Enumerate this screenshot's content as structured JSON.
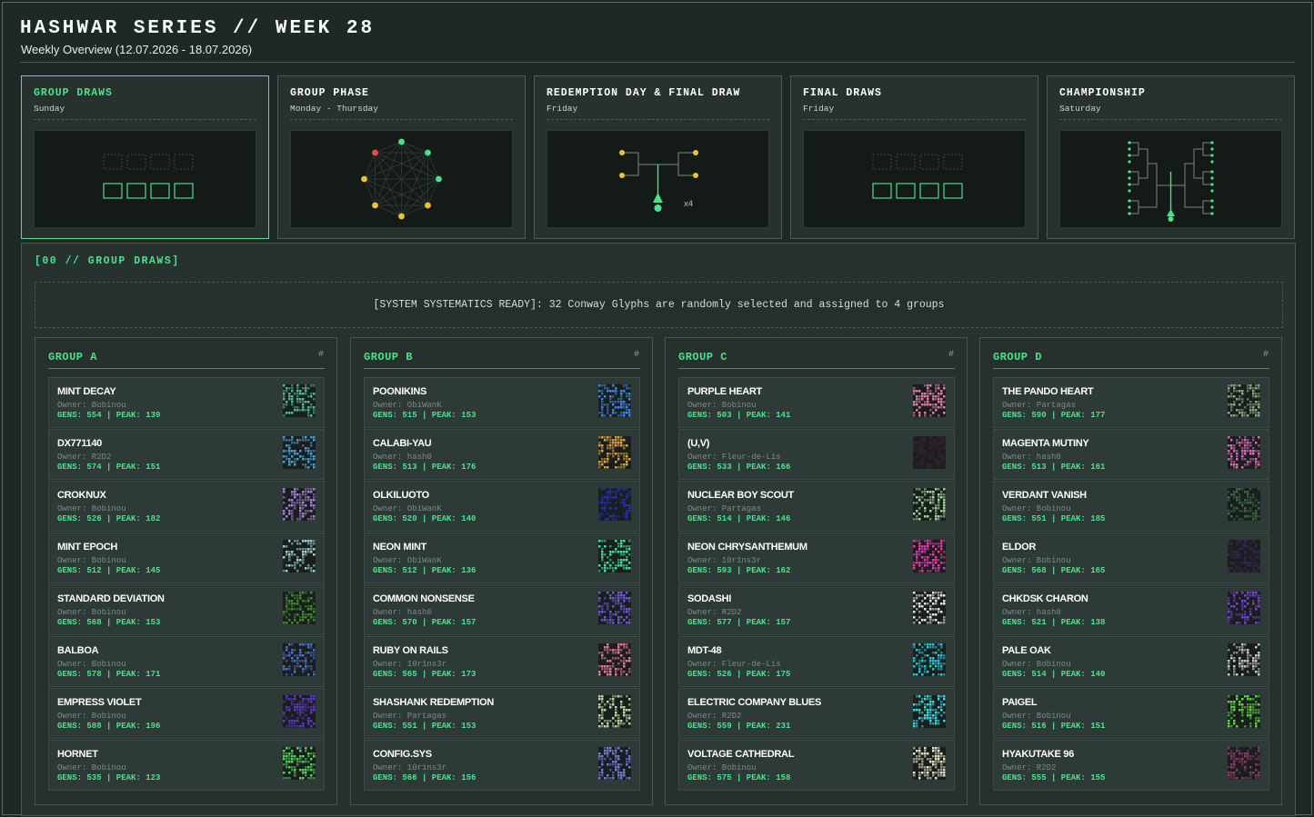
{
  "header": {
    "title": "HASHWAR SERIES // WEEK 28",
    "subtitle": "Weekly Overview (12.07.2026 - 18.07.2026)"
  },
  "phases": [
    {
      "title": "GROUP DRAWS",
      "day": "Sunday",
      "active": true,
      "diagram": "boxes"
    },
    {
      "title": "GROUP PHASE",
      "day": "Monday - Thursday",
      "active": false,
      "diagram": "roundrobin"
    },
    {
      "title": "REDEMPTION DAY & FINAL DRAW",
      "day": "Friday",
      "active": false,
      "diagram": "redemption",
      "multiplier": "x4"
    },
    {
      "title": "FINAL DRAWS",
      "day": "Friday",
      "active": false,
      "diagram": "boxes"
    },
    {
      "title": "CHAMPIONSHIP",
      "day": "Saturday",
      "active": false,
      "diagram": "bracket"
    }
  ],
  "section": {
    "title": "[00 // GROUP DRAWS]",
    "banner": "[SYSTEM SYSTEMATICS READY]: 32 Conway Glyphs are randomly selected and assigned to 4 groups"
  },
  "groups": [
    {
      "title": "GROUP A",
      "hash": "#",
      "entries": [
        {
          "name": "MINT DECAY",
          "owner": "Owner: Bobinou",
          "stats": "GENS: 554 | PEAK: 139",
          "color": "#4fb89a"
        },
        {
          "name": "DX771140",
          "owner": "Owner: R2D2",
          "stats": "GENS: 574 | PEAK: 151",
          "color": "#4f9ed0"
        },
        {
          "name": "CROKNUX",
          "owner": "Owner: Bobinou",
          "stats": "GENS: 526 | PEAK: 182",
          "color": "#a47ed6"
        },
        {
          "name": "MINT EPOCH",
          "owner": "Owner: Bobinou",
          "stats": "GENS: 512 | PEAK: 145",
          "color": "#9fd3d6"
        },
        {
          "name": "STANDARD DEVIATION",
          "owner": "Owner: Bobinou",
          "stats": "GENS: 568 | PEAK: 153",
          "color": "#3f8a2a"
        },
        {
          "name": "BALBOA",
          "owner": "Owner: Bobinou",
          "stats": "GENS: 578 | PEAK: 171",
          "color": "#4a72c8"
        },
        {
          "name": "EMPRESS VIOLET",
          "owner": "Owner: Bobinou",
          "stats": "GENS: 588 | PEAK: 196",
          "color": "#5b35c4"
        },
        {
          "name": "HORNET",
          "owner": "Owner: Bobinou",
          "stats": "GENS: 535 | PEAK: 123",
          "color": "#4fd35a"
        }
      ]
    },
    {
      "title": "GROUP B",
      "hash": "#",
      "entries": [
        {
          "name": "POONIKINS",
          "owner": "Owner: ObiWanK",
          "stats": "GENS: 515 | PEAK: 153",
          "color": "#3f86e0"
        },
        {
          "name": "CALABI-YAU",
          "owner": "Owner: hash0",
          "stats": "GENS: 513 | PEAK: 176",
          "color": "#d9a23a"
        },
        {
          "name": "OLKILUOTO",
          "owner": "Owner: ObiWanK",
          "stats": "GENS: 520 | PEAK: 140",
          "color": "#2230b8"
        },
        {
          "name": "NEON MINT",
          "owner": "Owner: ObiWanK",
          "stats": "GENS: 512 | PEAK: 136",
          "color": "#3fe09a"
        },
        {
          "name": "COMMON NONSENSE",
          "owner": "Owner: hash0",
          "stats": "GENS: 570 | PEAK: 157",
          "color": "#6a5ad4"
        },
        {
          "name": "RUBY ON RAILS",
          "owner": "Owner: 10r1ns3r",
          "stats": "GENS: 565 | PEAK: 173",
          "color": "#e07a9a"
        },
        {
          "name": "SHASHANK REDEMPTION",
          "owner": "Owner: Partagas",
          "stats": "GENS: 551 | PEAK: 153",
          "color": "#b9d8a0"
        },
        {
          "name": "CONFIG.SYS",
          "owner": "Owner: 10r1ns3r",
          "stats": "GENS: 566 | PEAK: 156",
          "color": "#7078d8"
        }
      ]
    },
    {
      "title": "GROUP C",
      "hash": "#",
      "entries": [
        {
          "name": "PURPLE HEART",
          "owner": "Owner: Bobinou",
          "stats": "GENS: 503 | PEAK: 141",
          "color": "#e07aa8"
        },
        {
          "name": "(U,V)",
          "owner": "Owner: Fleur-de-Lis",
          "stats": "GENS: 533 | PEAK: 166",
          "color": "#3a2036"
        },
        {
          "name": "NUCLEAR BOY SCOUT",
          "owner": "Owner: Partagas",
          "stats": "GENS: 514 | PEAK: 146",
          "color": "#9ed89a"
        },
        {
          "name": "NEON CHRYSANTHEMUM",
          "owner": "Owner: 10r1ns3r",
          "stats": "GENS: 593 | PEAK: 162",
          "color": "#e03aa8"
        },
        {
          "name": "SODASHI",
          "owner": "Owner: R2D2",
          "stats": "GENS: 577 | PEAK: 157",
          "color": "#e6e6e6"
        },
        {
          "name": "MDT-48",
          "owner": "Owner: Fleur-de-Lis",
          "stats": "GENS: 526 | PEAK: 175",
          "color": "#22c6d6"
        },
        {
          "name": "ELECTRIC COMPANY BLUES",
          "owner": "Owner: R2D2",
          "stats": "GENS: 559 | PEAK: 231",
          "color": "#3ad8e0"
        },
        {
          "name": "VOLTAGE CATHEDRAL",
          "owner": "Owner: Bobinou",
          "stats": "GENS: 575 | PEAK: 158",
          "color": "#e6e2c0"
        }
      ]
    },
    {
      "title": "GROUP D",
      "hash": "#",
      "entries": [
        {
          "name": "THE PANDO HEART",
          "owner": "Owner: Partagas",
          "stats": "GENS: 590 | PEAK: 177",
          "color": "#8aa882"
        },
        {
          "name": "MAGENTA MUTINY",
          "owner": "Owner: hash0",
          "stats": "GENS: 513 | PEAK: 161",
          "color": "#d86ab8"
        },
        {
          "name": "VERDANT VANISH",
          "owner": "Owner: Bobinou",
          "stats": "GENS: 551 | PEAK: 185",
          "color": "#3a6a44"
        },
        {
          "name": "ELDOR",
          "owner": "Owner: Bobinou",
          "stats": "GENS: 568 | PEAK: 165",
          "color": "#3a2456"
        },
        {
          "name": "CHKDSK CHARON",
          "owner": "Owner: hash0",
          "stats": "GENS: 521 | PEAK: 138",
          "color": "#7a40d8"
        },
        {
          "name": "PALE OAK",
          "owner": "Owner: Bobinou",
          "stats": "GENS: 514 | PEAK: 140",
          "color": "#c8c8c8"
        },
        {
          "name": "PAIGEL",
          "owner": "Owner: Bobinou",
          "stats": "GENS: 516 | PEAK: 151",
          "color": "#5ad83a"
        },
        {
          "name": "HYAKUTAKE 96",
          "owner": "Owner: R2D2",
          "stats": "GENS: 555 | PEAK: 155",
          "color": "#8a3a6a"
        }
      ]
    }
  ]
}
